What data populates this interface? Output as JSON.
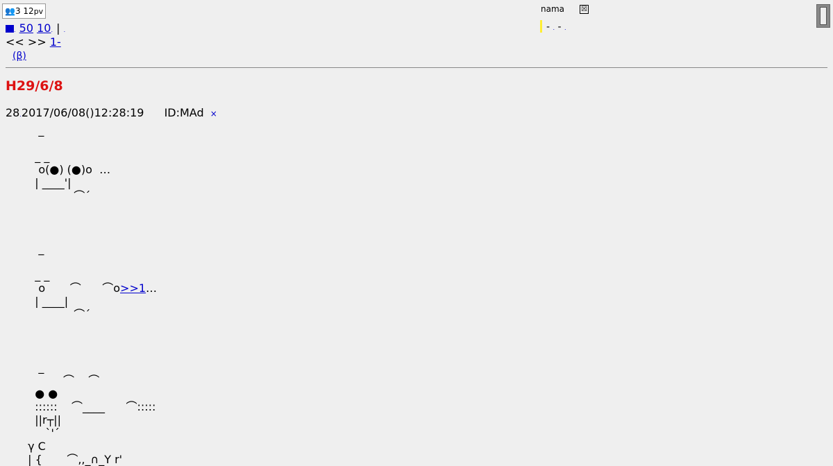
{
  "counter": {
    "people": "3",
    "pv_num": "12",
    "pv_unit": "pv"
  },
  "topnav": {
    "square_icon": "square-icon",
    "link_50": "50",
    "link_10": "10",
    "separator": "|"
  },
  "nav2": {
    "prev": "<<",
    "next": ">>",
    "link_1": "1-"
  },
  "beta_link": "(β)",
  "name_box": {
    "label": "nama",
    "close": "☒"
  },
  "strip": {
    "dash1": "-",
    "dash2": "-"
  },
  "thread": {
    "title": "H29/6/8"
  },
  "post": {
    "number": "28",
    "date": "2017/06/08()12:28:19",
    "id": "ID:MAd",
    "x_icon": "×",
    "art_1": "    _\n\n   _ _\n    o(●) (●)o  …\n   | ____'|\n              ⌒´\n\n\n\n    _\n\n   _ _\n    o       ⌒      ⌒o",
    "reply_link": ">>1",
    "art_1_tail": "…\n   | ____|\n              ⌒´\n\n\n\n    _\n           ⌒    ⌒\n   ● ●\n   ::::::    ⌒____      ⌒:::::\n   ||r┬||\n      `'´\n γ C\n | {       ⌒,,_∩_Y r'"
  }
}
